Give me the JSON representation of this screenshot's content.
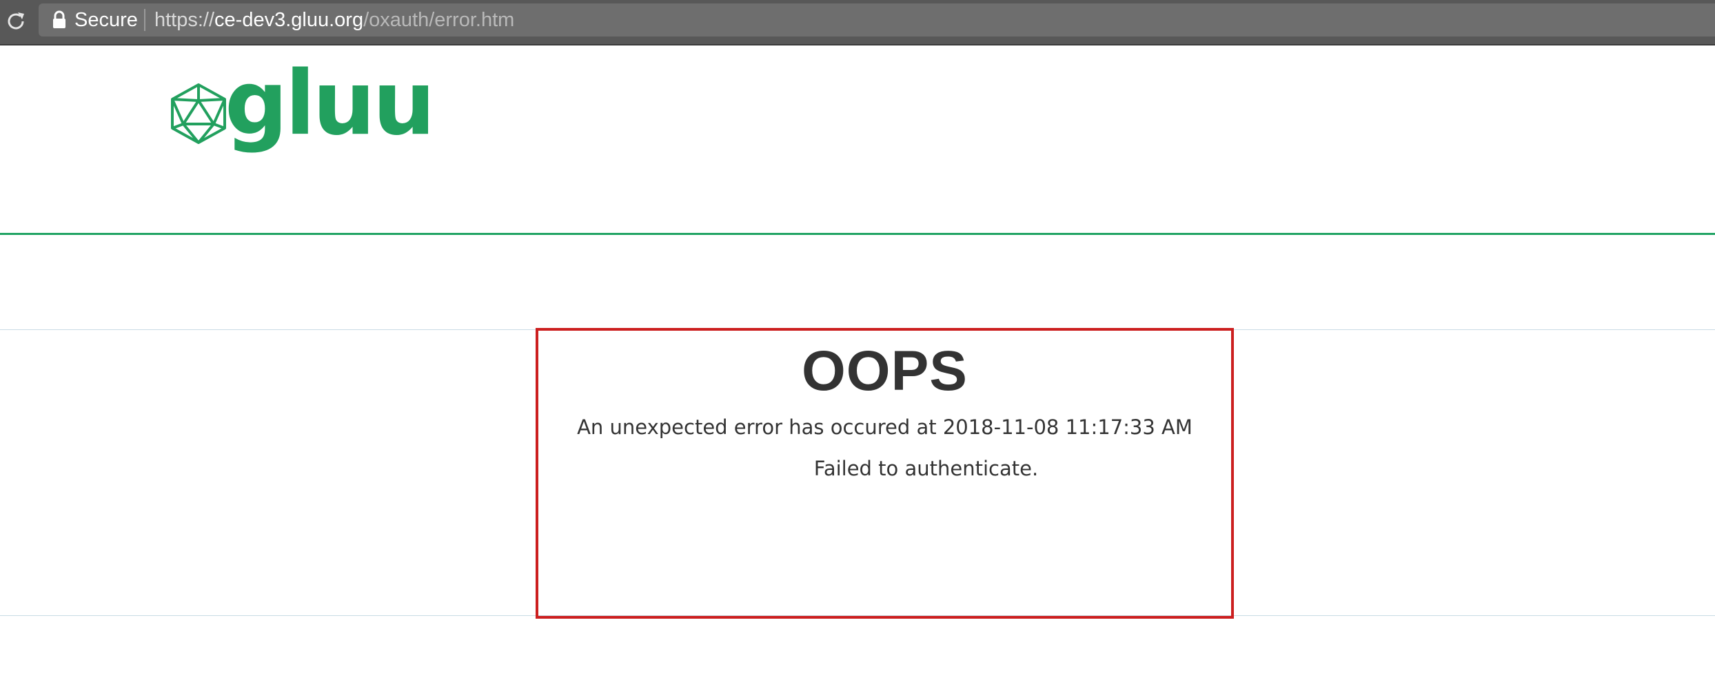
{
  "browser": {
    "secure_label": "Secure",
    "url_scheme": "https://",
    "url_host": "ce-dev3.gluu.org",
    "url_path": "/oxauth/error.htm"
  },
  "logo": {
    "text": "gluu",
    "brand_color": "#22a05e"
  },
  "error": {
    "title": "OOPS",
    "message": "An unexpected error has occured at 2018-11-08 11:17:33 AM",
    "detail": "Failed to authenticate.",
    "box_color": "#cc1f1f"
  },
  "colors": {
    "header_rule": "#1fa363",
    "content_rule": "#c8dbe4",
    "text": "#333333"
  },
  "icons": {
    "reload": "reload-icon",
    "lock": "lock-icon",
    "logo": "icosahedron-icon"
  }
}
